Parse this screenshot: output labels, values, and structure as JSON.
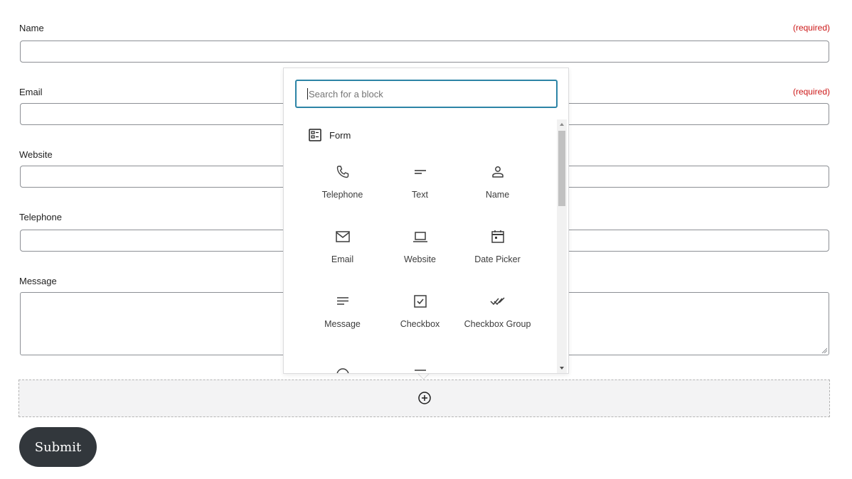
{
  "form": {
    "required_text": "(required)",
    "fields": {
      "name": {
        "label": "Name"
      },
      "email": {
        "label": "Email"
      },
      "website": {
        "label": "Website"
      },
      "telephone": {
        "label": "Telephone"
      },
      "message": {
        "label": "Message"
      }
    },
    "submit_label": "Submit"
  },
  "inserter": {
    "search_placeholder": "Search for a block",
    "category": {
      "label": "Form",
      "icon": "form-icon"
    },
    "blocks": [
      {
        "label": "Telephone",
        "icon": "phone-icon"
      },
      {
        "label": "Text",
        "icon": "text-icon"
      },
      {
        "label": "Name",
        "icon": "person-icon"
      },
      {
        "label": "Email",
        "icon": "envelope-icon"
      },
      {
        "label": "Website",
        "icon": "laptop-icon"
      },
      {
        "label": "Date Picker",
        "icon": "calendar-icon"
      },
      {
        "label": "Message",
        "icon": "lines-icon"
      },
      {
        "label": "Checkbox",
        "icon": "checkbox-icon"
      },
      {
        "label": "Checkbox Group",
        "icon": "double-check-icon"
      }
    ]
  },
  "colors": {
    "accent": "#2c84a6",
    "required": "#cc1818",
    "submit_bg": "#32373c"
  }
}
